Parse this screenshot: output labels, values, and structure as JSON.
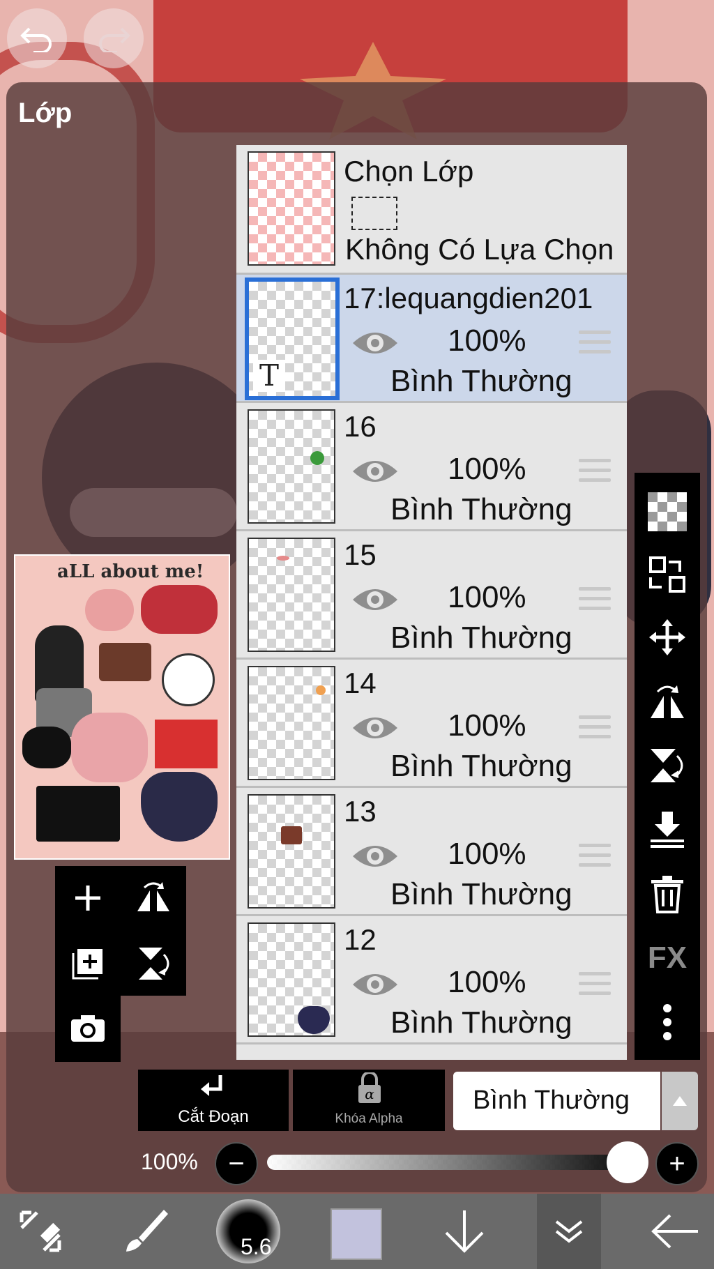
{
  "panel": {
    "title": "Lớp"
  },
  "selection_layer": {
    "title": "Chọn Lớp",
    "status": "Không Có Lựa Chọn"
  },
  "layers": [
    {
      "name": "17:lequangdien201",
      "opacity": "100%",
      "blend": "Bình Thường",
      "selected": true,
      "type": "text"
    },
    {
      "name": "16",
      "opacity": "100%",
      "blend": "Bình Thường",
      "selected": false
    },
    {
      "name": "15",
      "opacity": "100%",
      "blend": "Bình Thường",
      "selected": false
    },
    {
      "name": "14",
      "opacity": "100%",
      "blend": "Bình Thường",
      "selected": false
    },
    {
      "name": "13",
      "opacity": "100%",
      "blend": "Bình Thường",
      "selected": false
    },
    {
      "name": "12",
      "opacity": "100%",
      "blend": "Bình Thường",
      "selected": false
    }
  ],
  "text_layer_badge": "T",
  "controls": {
    "clip_label": "Cắt Đoạn",
    "alpha_lock_label": "Khóa Alpha",
    "blend_mode": "Bình Thường",
    "opacity_label": "100%",
    "opacity_value": 1.0,
    "minus_symbol": "−",
    "plus_symbol": "+"
  },
  "right_tools": {
    "fx_label": "FX"
  },
  "bottom_bar": {
    "brush_size": "5.6",
    "color": "#c2c2dd"
  },
  "colors": {
    "selected_highlight": "#ccd7ea",
    "selected_border": "#2a6fd6"
  }
}
